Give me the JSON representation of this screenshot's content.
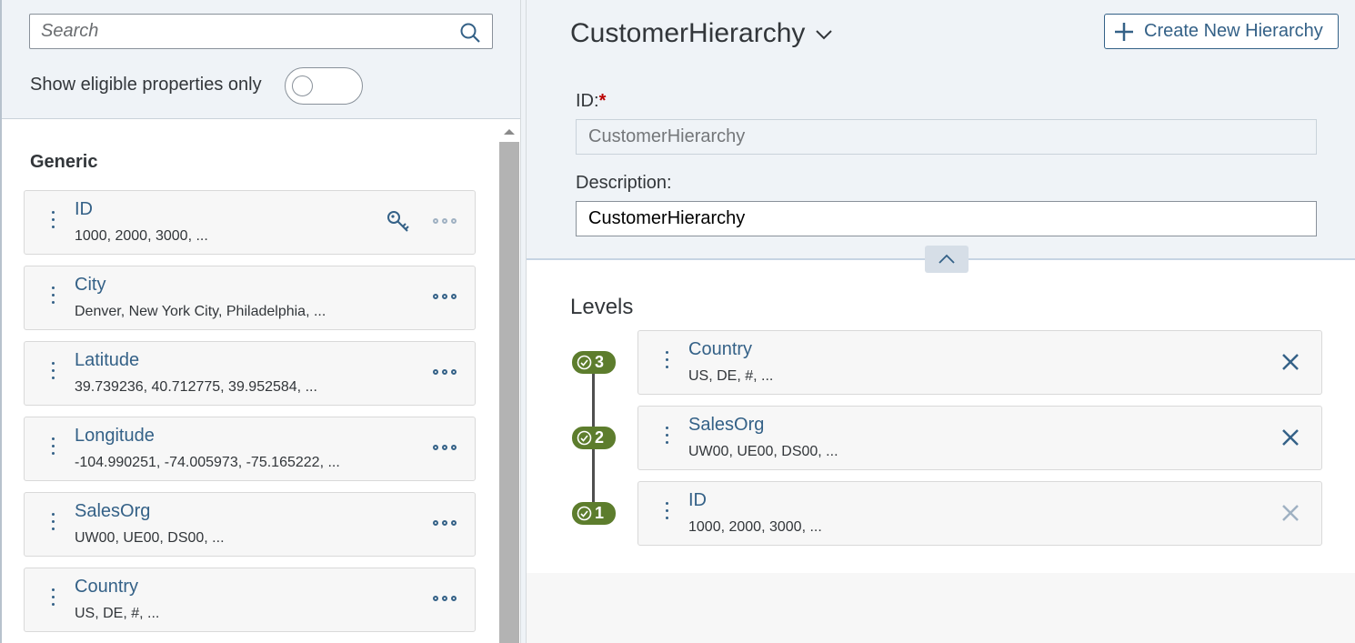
{
  "left": {
    "search_placeholder": "Search",
    "eligible_label": "Show eligible properties only",
    "eligible_on": false,
    "group_title": "Generic",
    "properties": [
      {
        "name": "ID",
        "values": "1000, 2000, 3000, ...",
        "key": true
      },
      {
        "name": "City",
        "values": "Denver, New York City, Philadelphia, ..."
      },
      {
        "name": "Latitude",
        "values": "39.739236, 40.712775, 39.952584, ..."
      },
      {
        "name": "Longitude",
        "values": "-104.990251, -74.005973, -75.165222, ..."
      },
      {
        "name": "SalesOrg",
        "values": "UW00, UE00, DS00, ..."
      },
      {
        "name": "Country",
        "values": "US, DE, #, ..."
      }
    ]
  },
  "right": {
    "hierarchy_name": "CustomerHierarchy",
    "create_button": "Create New Hierarchy",
    "id_label": "ID:",
    "id_required_mark": "*",
    "id_value": "CustomerHierarchy",
    "description_label": "Description:",
    "description_value": "CustomerHierarchy",
    "levels_title": "Levels",
    "levels": [
      {
        "number": "3",
        "name": "Country",
        "values": "US, DE, #, ..."
      },
      {
        "number": "2",
        "name": "SalesOrg",
        "values": "UW00, UE00, DS00, ..."
      },
      {
        "number": "1",
        "name": "ID",
        "values": "1000, 2000, 3000, ..."
      }
    ]
  },
  "colors": {
    "accent": "#346187",
    "level_badge": "#5d7d2d",
    "header_bg": "#eff3f7",
    "required": "#bb0000"
  },
  "icons": [
    "search-icon",
    "key-icon",
    "more-icon",
    "drag-handle-icon",
    "chevron-down-icon",
    "plus-icon",
    "chevron-up-icon",
    "check-circle-icon",
    "close-icon"
  ]
}
